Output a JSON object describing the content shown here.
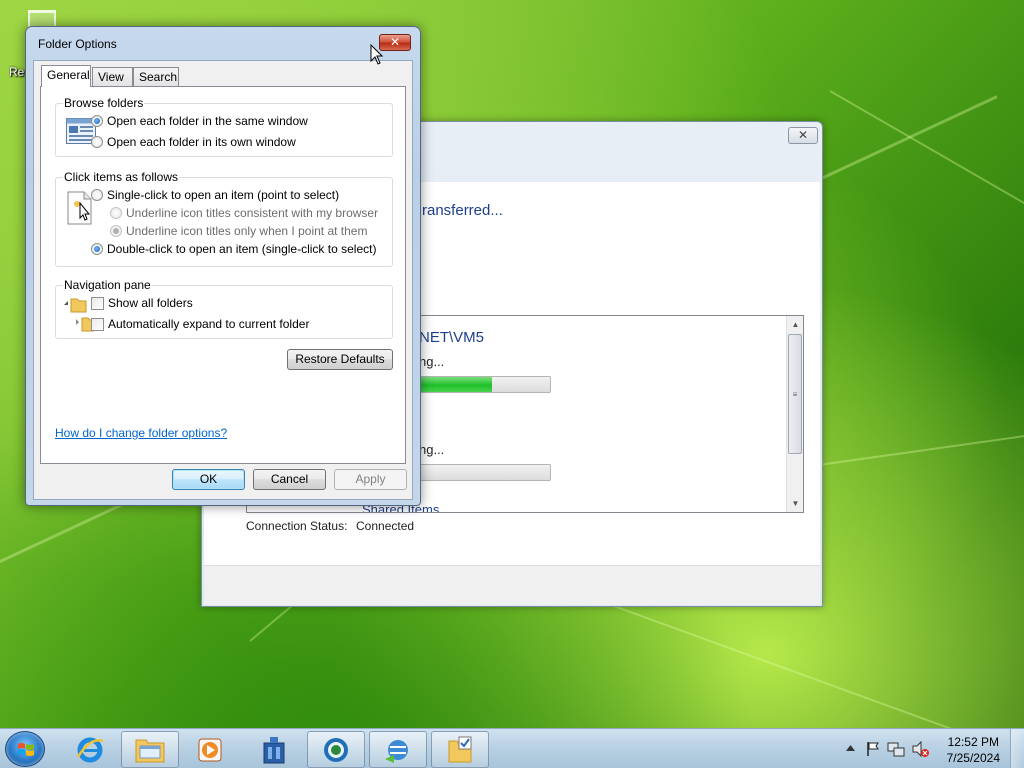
{
  "desktop": {
    "recycle_bin_label": "Recycle Bin"
  },
  "bg_window": {
    "close_glyph": "✕",
    "heading_partial": "ransferred...",
    "items": [
      {
        "host_partial": "NET\\VM5",
        "status_partial": "ng...",
        "progress": 0.55
      },
      {
        "status_partial": "ng...",
        "progress": 0.0
      }
    ],
    "cut_off_text": "Shared Items",
    "connection_status_label": "Connection Status:",
    "connection_status_value": "Connected"
  },
  "dialog": {
    "title": "Folder Options",
    "close_glyph": "✕",
    "tabs": [
      {
        "label": "General",
        "active": true
      },
      {
        "label": "View",
        "active": false
      },
      {
        "label": "Search",
        "active": false
      }
    ],
    "browse_folders": {
      "title": "Browse folders",
      "options": [
        {
          "label": "Open each folder in the same window",
          "selected": true
        },
        {
          "label": "Open each folder in its own window",
          "selected": false
        }
      ]
    },
    "click_items": {
      "title": "Click items as follows",
      "single_click": {
        "label": "Single-click to open an item (point to select)",
        "selected": false
      },
      "sub_options": [
        {
          "label": "Underline icon titles consistent with my browser",
          "selected": false
        },
        {
          "label": "Underline icon titles only when I point at them",
          "selected": true
        }
      ],
      "double_click": {
        "label": "Double-click to open an item (single-click to select)",
        "selected": true
      }
    },
    "navigation_pane": {
      "title": "Navigation pane",
      "options": [
        {
          "label": "Show all folders",
          "checked": false
        },
        {
          "label": "Automatically expand to current folder",
          "checked": false
        }
      ]
    },
    "restore_defaults": "Restore Defaults",
    "help_link": "How do I change folder options?",
    "buttons": {
      "ok": "OK",
      "cancel": "Cancel",
      "apply": "Apply"
    }
  },
  "taskbar": {
    "start_icon": "windows-orb-icon",
    "pinned": [
      "internet-explorer-icon",
      "windows-explorer-icon",
      "media-player-icon",
      "network-app-icon",
      "browser-globe-icon",
      "network-transfer-icon",
      "folder-options-icon"
    ],
    "tray_icons": [
      "show-hidden-icons-arrow",
      "action-center-flag-icon",
      "network-icon",
      "volume-muted-icon"
    ],
    "clock": {
      "time": "12:52 PM",
      "date": "7/25/2024"
    }
  }
}
